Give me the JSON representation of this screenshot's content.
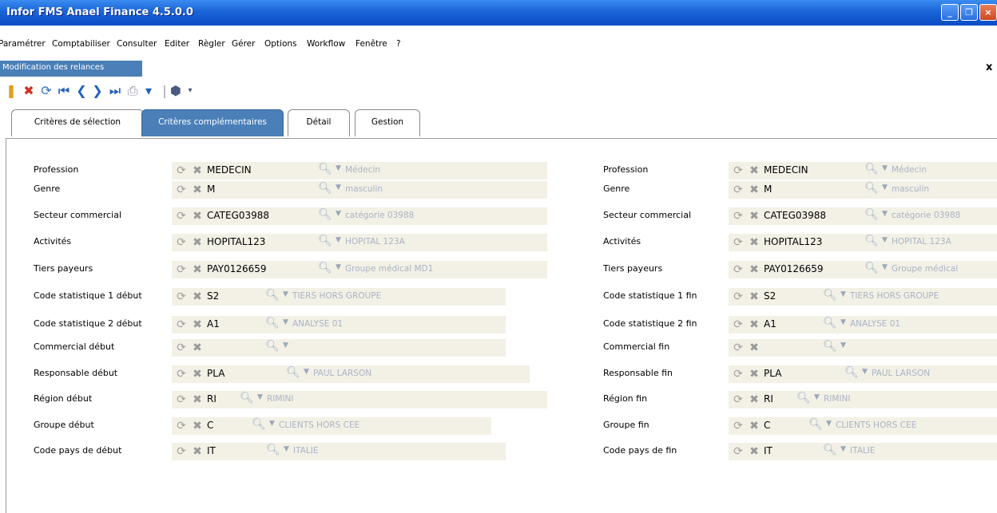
{
  "window": {
    "title": "Infor FMS Anael Finance 4.5.0.0",
    "close_x": "×"
  },
  "menu": [
    "Paramétrer",
    "Comptabiliser",
    "Consulter",
    "Editer",
    "Règler",
    "Gérer",
    "Options",
    "Workflow",
    "Fenêtre",
    "?"
  ],
  "doc_tab": {
    "label": "Modification des relances",
    "close": "x"
  },
  "tabs": [
    "Critères de sélection",
    "Critères complémentaires",
    "Détail",
    "Gestion"
  ],
  "active_tab": "Critères complémentaires",
  "form_left": [
    {
      "label": "Profession",
      "code": "MEDECIN",
      "desc": "Médecin"
    },
    {
      "label": "Genre",
      "code": "M",
      "desc": "masculin"
    },
    {
      "label": "Secteur commercial",
      "code": "CATEG03988",
      "desc": "catégorie 03988"
    },
    {
      "label": "Activités",
      "code": "HOPITAL123",
      "desc": "HOPITAL 123A"
    },
    {
      "label": "Tiers payeurs",
      "code": "PAY0126659",
      "desc": "Groupe médical MD1"
    },
    {
      "label": "Code statistique 1 début",
      "code": "S2",
      "desc": "TIERS HORS GROUPE"
    },
    {
      "label": "Code statistique 2 début",
      "code": "A1",
      "desc": "ANALYSE 01"
    },
    {
      "label": "Commercial début",
      "code": "",
      "desc": ""
    },
    {
      "label": "Responsable début",
      "code": "PLA",
      "desc": "PAUL LARSON"
    },
    {
      "label": "Région début",
      "code": "RI",
      "desc": "RIMINI"
    },
    {
      "label": "Groupe début",
      "code": "C",
      "desc": "CLIENTS HORS CEE"
    },
    {
      "label": "Code pays de début",
      "code": "IT",
      "desc": "ITALIE"
    }
  ],
  "form_right": [
    {
      "label": "Profession",
      "code": "MEDECIN",
      "desc": "Médecin"
    },
    {
      "label": "Genre",
      "code": "M",
      "desc": "masculin"
    },
    {
      "label": "Secteur commercial",
      "code": "CATEG03988",
      "desc": "catégorie 03988"
    },
    {
      "label": "Activités",
      "code": "HOPITAL123",
      "desc": "HOPITAL 123A"
    },
    {
      "label": "Tiers payeurs",
      "code": "PAY0126659",
      "desc": "Groupe médical"
    },
    {
      "label": "Code statistique 1 fin",
      "code": "S2",
      "desc": "TIERS HORS GROUPE"
    },
    {
      "label": "Code statistique 2 fin",
      "code": "A1",
      "desc": "ANALYSE 01"
    },
    {
      "label": "Commercial fin",
      "code": "",
      "desc": ""
    },
    {
      "label": "Responsable fin",
      "code": "PLA",
      "desc": "PAUL LARSON"
    },
    {
      "label": "Région fin",
      "code": "RI",
      "desc": "RIMINI"
    },
    {
      "label": "Groupe fin",
      "code": "C",
      "desc": "CLIENTS HORS CEE"
    },
    {
      "label": "Code pays de fin",
      "code": "IT",
      "desc": "ITALIE"
    }
  ],
  "icons": {
    "refresh": "refresh-icon",
    "delete": "delete-icon",
    "search": "search-icon",
    "dropdown": "dropdown-arrow-icon"
  },
  "colors": {
    "titlebar": "#1a64d8",
    "active_tab": "#4a7fb8",
    "field_bg": "#f3f0e6",
    "desc_text": "#a8b4c4"
  }
}
